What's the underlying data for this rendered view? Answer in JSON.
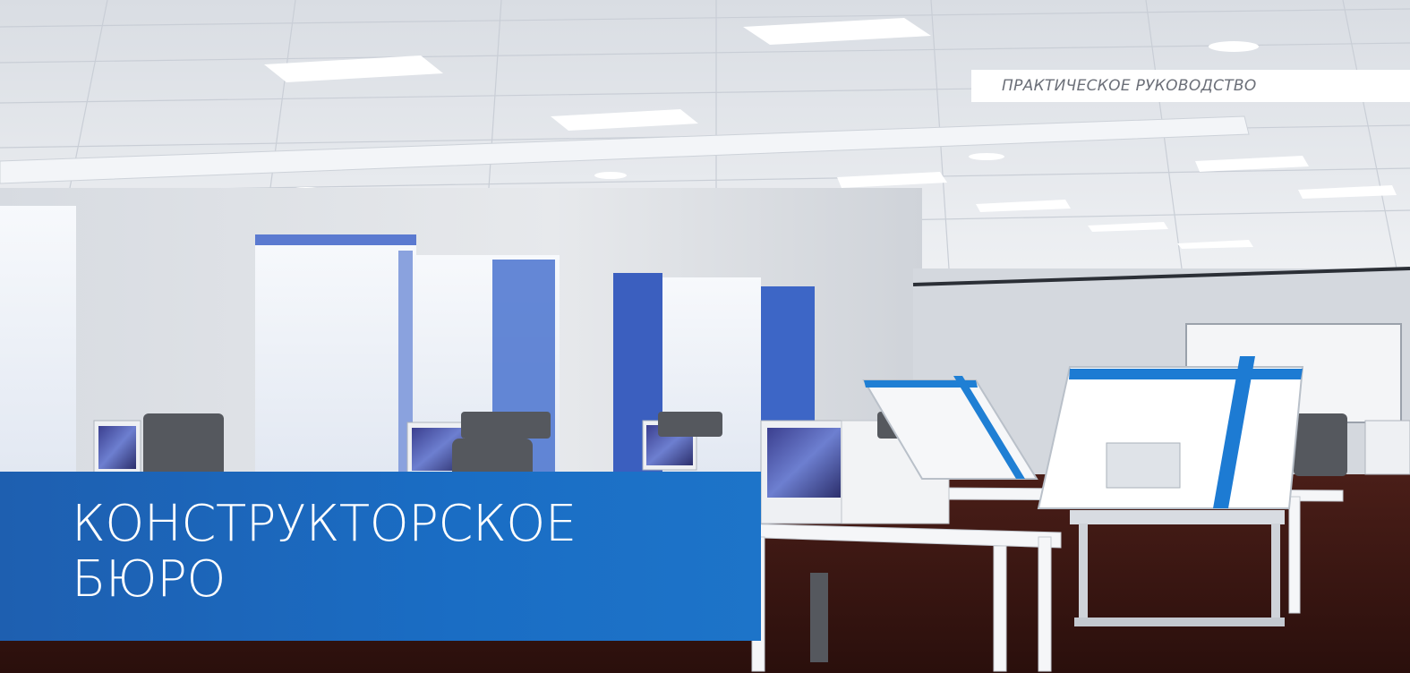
{
  "header": {
    "tag": "ПРАКТИЧЕСКОЕ РУКОВОДСТВО"
  },
  "title": {
    "line1": "КОНСТРУКТОРСКОЕ",
    "line2": "БЮРО"
  },
  "colors": {
    "brand_blue": "#1a6dc4",
    "tag_text": "#6b6f78",
    "ceiling": "#e6e9ee",
    "floor": "#3b1712",
    "curtain_blue": "#3a62b8"
  }
}
